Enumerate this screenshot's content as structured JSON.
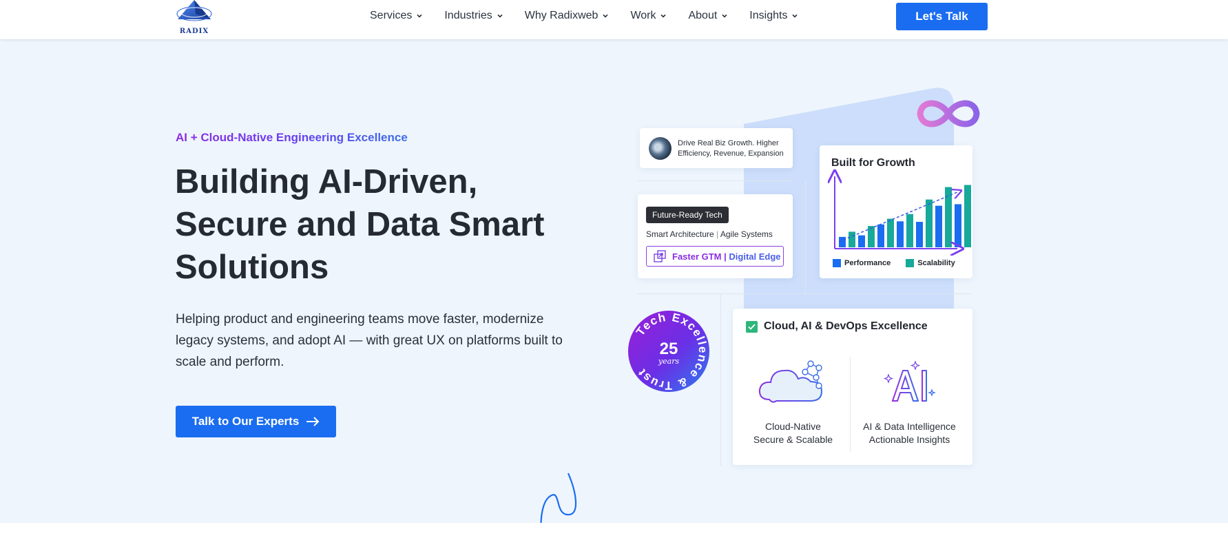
{
  "header": {
    "logo_text": "RADIX",
    "nav": [
      {
        "label": "Services"
      },
      {
        "label": "Industries"
      },
      {
        "label": "Why Radixweb"
      },
      {
        "label": "Work"
      },
      {
        "label": "About"
      },
      {
        "label": "Insights"
      }
    ],
    "cta_label": "Let's Talk"
  },
  "hero": {
    "eyebrow": "AI + Cloud-Native Engineering Excellence",
    "headline_l1": "Building AI-Driven,",
    "headline_l2": "Secure and Data Smart",
    "headline_l3": "Solutions",
    "subcopy": "Helping product and engineering teams move faster, modernize legacy systems, and adopt AI — with great UX on platforms built to scale and perform.",
    "cta_label": "Talk to Our Experts"
  },
  "cards": {
    "growth_message": "Drive Real Biz Growth. Higher Efficiency, Revenue, Expansion",
    "future_badge": "Future-Ready Tech",
    "future_line_a": "Smart Architecture",
    "future_line_sep": "|",
    "future_line_b": "Agile Systems",
    "future_btn_a": "Faster GTM |",
    "future_btn_b": "Digital Edge",
    "chart_title": "Built for Growth",
    "legend_a": "Performance",
    "legend_b": "Scalability",
    "cloud_heading": "Cloud, AI & DevOps Excellence",
    "col1_l1": "Cloud-Native",
    "col1_l2": "Secure & Scalable",
    "col2_l1": "AI & Data Intelligence",
    "col2_l2": "Actionable Insights",
    "badge_number": "25",
    "badge_sub": "years",
    "badge_ring": "Tech Excellence & Trust"
  },
  "colors": {
    "primary": "#1a6df0",
    "accent_purple": "#8b2de2",
    "teal": "#17a99a",
    "hero_bg": "#eef5fd"
  },
  "chart_data": {
    "type": "bar",
    "categories": [
      "1",
      "2",
      "3",
      "4",
      "5",
      "6",
      "7"
    ],
    "series": [
      {
        "name": "Performance",
        "values": [
          2,
          2.3,
          4.4,
          5,
          4.9,
          8,
          8.3
        ]
      },
      {
        "name": "Scalability",
        "values": [
          3,
          4.1,
          5.5,
          6.4,
          9.2,
          11.6,
          12
        ]
      }
    ],
    "ylim": [
      0,
      13
    ],
    "grid": false
  }
}
